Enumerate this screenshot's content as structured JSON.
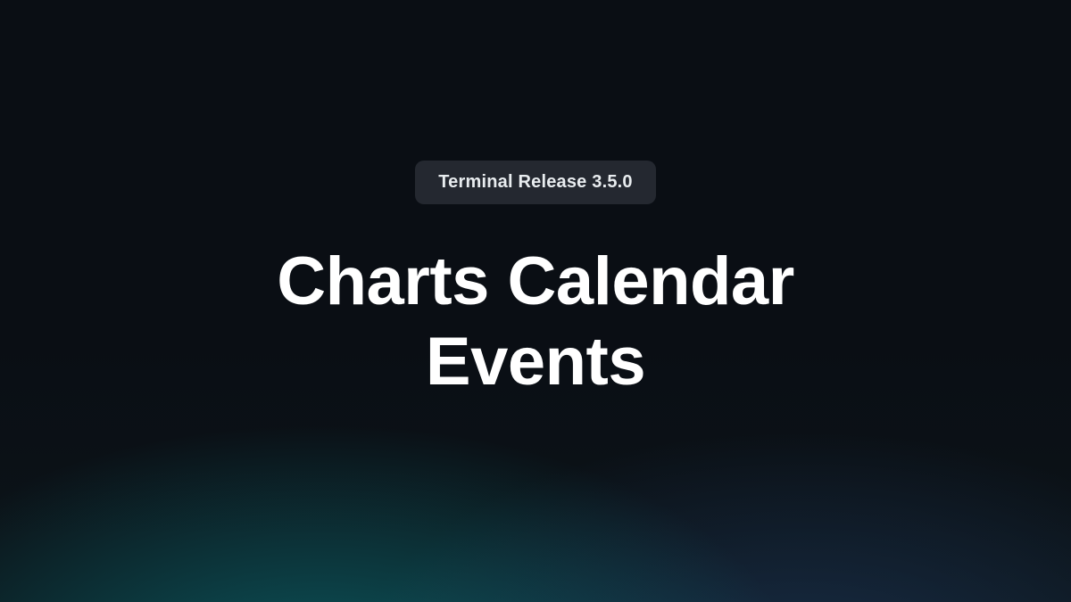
{
  "badge": {
    "label": "Terminal Release 3.5.0"
  },
  "hero": {
    "title_line1": "Charts Calendar",
    "title_line2": "Events"
  }
}
